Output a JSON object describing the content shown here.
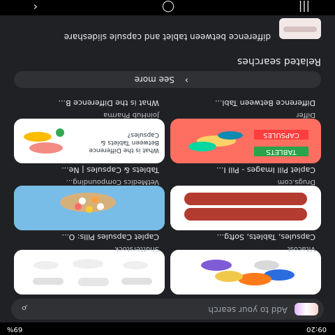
{
  "status": {
    "time": "09:20",
    "right": "69%"
  },
  "search": {
    "placeholder": "Add to your search",
    "icon": "search-icon"
  },
  "results": [
    {
      "source": "Vitacost",
      "title": "Capsules, Tablets, Softg..."
    },
    {
      "source": "Shutterstock",
      "title": "Caplet Capsules Pills: O..."
    },
    {
      "source": "Drugs.com",
      "title": "Caplet Pill Images - Pill I..."
    },
    {
      "source": "VetMedics Compounding...",
      "title": "Tablets & Capsules | Ne..."
    },
    {
      "source": "Differ",
      "title": "Difference Between Tabl..."
    },
    {
      "source": "JoinHub Pharma",
      "title": "What is the Difference B..."
    }
  ],
  "cards": {
    "tablets_label": "TABLETS",
    "capsules_label": "CAPSULES",
    "diff_label": "What is the Difference Between Tablets & Capsules?"
  },
  "see_more": "See more",
  "related_searches": "Related searches",
  "related_item": "difference between tablet and capsule slideshare"
}
